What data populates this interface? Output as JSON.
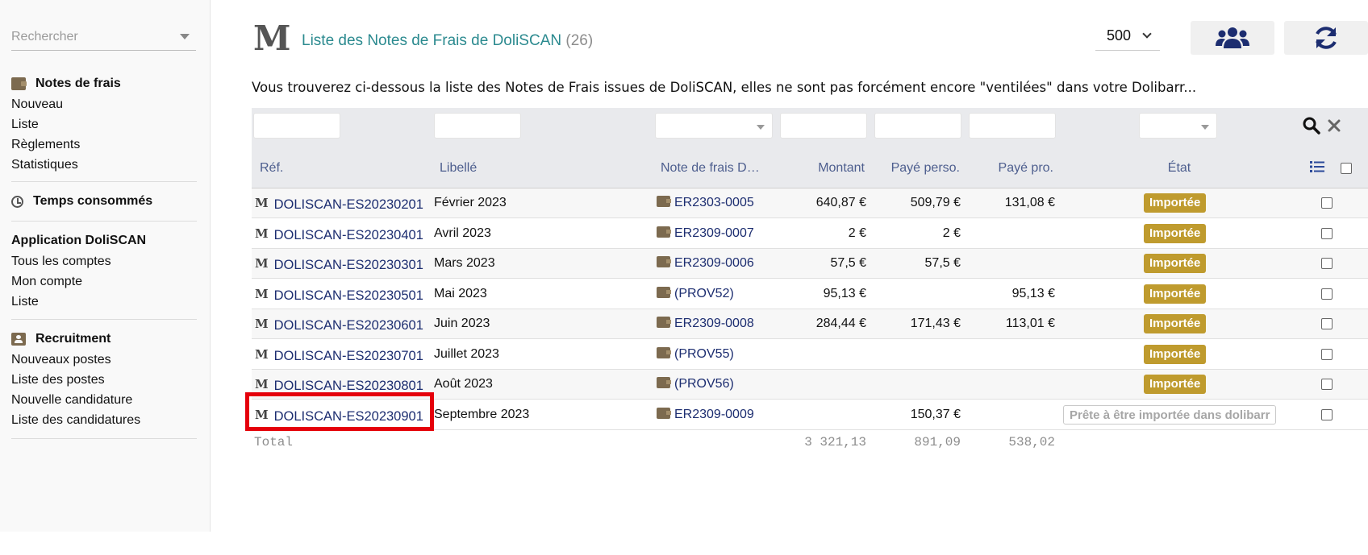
{
  "sidebar": {
    "search_placeholder": "Rechercher",
    "sections": [
      {
        "title": "Notes de frais",
        "icon": "wallet-icon",
        "items": [
          "Nouveau",
          "Liste",
          "Règlements",
          "Statistiques"
        ]
      },
      {
        "title": "Temps consommés",
        "icon": "clock-icon",
        "items": []
      },
      {
        "title": "Application DoliSCAN",
        "icon": "",
        "items": [
          "Tous les comptes",
          "Mon compte",
          "Liste"
        ]
      },
      {
        "title": "Recruitment",
        "icon": "id-badge-icon",
        "items": [
          "Nouveaux postes",
          "Liste des postes",
          "Nouvelle candidature",
          "Liste des candidatures"
        ]
      }
    ]
  },
  "header": {
    "logo": "M",
    "title": "Liste des Notes de Frais de DoliSCAN",
    "count": "(26)",
    "limit": "500",
    "buttons": [
      "users-icon",
      "refresh-icon"
    ]
  },
  "intro": "Vous trouverez ci-dessous la liste des Notes de Frais issues de DoliSCAN, elles ne sont pas forcément encore \"ventilées\" dans votre Dolibarr...",
  "table": {
    "columns": {
      "ref": "Réf.",
      "libelle": "Libellé",
      "ndf": "Note de frais D…",
      "montant": "Montant",
      "paye_perso": "Payé perso.",
      "paye_pro": "Payé pro.",
      "etat": "État"
    },
    "rows": [
      {
        "ref": "DOLISCAN-ES20230201",
        "libelle": "Février 2023",
        "ndf": "ER2303-0005",
        "montant": "640,87 €",
        "paye_perso": "509,79 €",
        "paye_pro": "131,08 €",
        "etat": "Importée",
        "etat_type": "imported"
      },
      {
        "ref": "DOLISCAN-ES20230401",
        "libelle": "Avril 2023",
        "ndf": "ER2309-0007",
        "montant": "2 €",
        "paye_perso": "2 €",
        "paye_pro": "",
        "etat": "Importée",
        "etat_type": "imported"
      },
      {
        "ref": "DOLISCAN-ES20230301",
        "libelle": "Mars 2023",
        "ndf": "ER2309-0006",
        "montant": "57,5 €",
        "paye_perso": "57,5 €",
        "paye_pro": "",
        "etat": "Importée",
        "etat_type": "imported"
      },
      {
        "ref": "DOLISCAN-ES20230501",
        "libelle": "Mai 2023",
        "ndf": "(PROV52)",
        "montant": "95,13 €",
        "paye_perso": "",
        "paye_pro": "95,13 €",
        "etat": "Importée",
        "etat_type": "imported"
      },
      {
        "ref": "DOLISCAN-ES20230601",
        "libelle": "Juin 2023",
        "ndf": "ER2309-0008",
        "montant": "284,44 €",
        "paye_perso": "171,43 €",
        "paye_pro": "113,01 €",
        "etat": "Importée",
        "etat_type": "imported"
      },
      {
        "ref": "DOLISCAN-ES20230701",
        "libelle": "Juillet 2023",
        "ndf": "(PROV55)",
        "montant": "",
        "paye_perso": "",
        "paye_pro": "",
        "etat": "Importée",
        "etat_type": "imported"
      },
      {
        "ref": "DOLISCAN-ES20230801",
        "libelle": "Août 2023",
        "ndf": "(PROV56)",
        "montant": "",
        "paye_perso": "",
        "paye_pro": "",
        "etat": "Importée",
        "etat_type": "imported"
      },
      {
        "ref": "DOLISCAN-ES20230901",
        "libelle": "Septembre 2023",
        "ndf": "ER2309-0009",
        "montant": "",
        "paye_perso": "150,37 €",
        "paye_pro": "",
        "etat": "Prête à être importée dans dolibarr",
        "etat_type": "ready"
      }
    ],
    "total": {
      "label": "Total",
      "montant": "3 321,13",
      "paye_perso": "891,09",
      "paye_pro": "538,02"
    }
  },
  "colors": {
    "title": "#2b8a8f",
    "link": "#1c2d70",
    "header_text": "#4d5e8e",
    "status_imported": "#bf9b2e",
    "highlight": "#e5000b"
  }
}
